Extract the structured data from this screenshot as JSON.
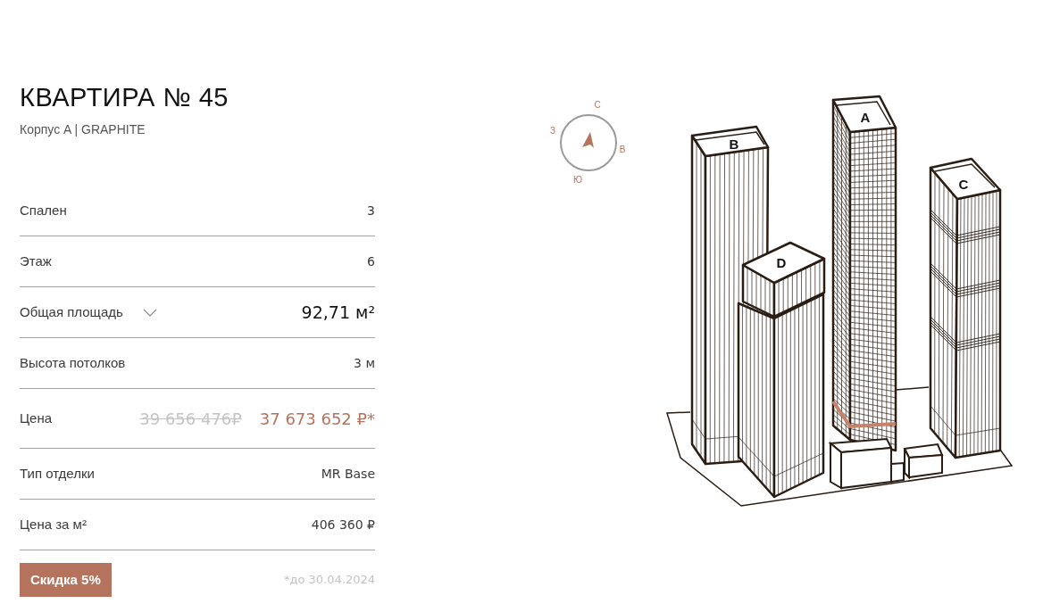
{
  "title": "КВАРТИРА № 45",
  "subtitle": "Корпус A | GRAPHITE",
  "specs": [
    {
      "kind": "plain",
      "label": "Спален",
      "value": "3"
    },
    {
      "kind": "plain",
      "label": "Этаж",
      "value": "6"
    },
    {
      "kind": "expandable",
      "label": "Общая площадь",
      "value": "92,71 м²",
      "expanded": false
    },
    {
      "kind": "plain",
      "label": "Высота потолков",
      "value": "3 м"
    },
    {
      "kind": "price",
      "label": "Цена",
      "old_value": "39 656 476₽",
      "value": "37 673 652 ₽*"
    },
    {
      "kind": "plain",
      "label": "Тип отделки",
      "value": "MR Base"
    },
    {
      "kind": "plain",
      "label": "Цена за м²",
      "value": "406 360 ₽"
    }
  ],
  "discount": {
    "label": "Скидка 5%",
    "note": "*до 30.04.2024"
  },
  "compass": [
    "С",
    "В",
    "Ю",
    "З"
  ],
  "buildings": [
    {
      "label": "B",
      "selected": false
    },
    {
      "label": "D",
      "selected": false
    },
    {
      "label": "A",
      "selected": true
    },
    {
      "label": "C",
      "selected": false
    }
  ]
}
